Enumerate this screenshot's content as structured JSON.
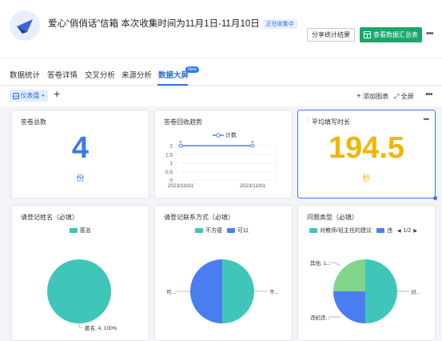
{
  "header": {
    "title": "爱心“俏俏话”信箱 本次收集时间为11月1日-11月10日",
    "status_badge": "正在收集中",
    "share_label": "分享统计结果",
    "view_data_label": "查看数据汇总表"
  },
  "tabs": [
    {
      "label": "数据统计"
    },
    {
      "label": "答卷详情"
    },
    {
      "label": "交叉分析"
    },
    {
      "label": "来源分析"
    },
    {
      "label": "数据大屏",
      "badge": "New",
      "active": true
    }
  ],
  "toolbar": {
    "dashboard_label": "仪表盘",
    "add_chart_label": "添加图表",
    "fullscreen_label": "全屏"
  },
  "cards": {
    "total": {
      "title": "答卷总数",
      "value": "4",
      "unit": "份"
    },
    "trend": {
      "title": "答卷回收趋势",
      "legend": "计数"
    },
    "avg_time": {
      "title": "平均填写时长",
      "value": "194.5",
      "unit": "秒"
    },
    "q1": {
      "title": "请登记姓名（必填）",
      "legend": "匿名",
      "label": "匿名, 4, 100%"
    },
    "q2": {
      "title": "请登记联系方式（必填）",
      "legends": [
        "不方便",
        "可以"
      ],
      "label_left": "可...",
      "label_right": "不..."
    },
    "q3": {
      "title": "问题类型（必填）",
      "legends": [
        "对教师/班主任的建议",
        "违"
      ],
      "pager": "1/2",
      "label_tl": "其他, 1...",
      "label_bl": "违纪违...",
      "label_r": "对..."
    }
  },
  "chart_data": [
    {
      "type": "line",
      "title": "答卷回收趋势",
      "x": [
        "2023/10/31",
        "2023/11/01"
      ],
      "series": [
        {
          "name": "计数",
          "values": [
            2,
            2
          ]
        }
      ],
      "yticks": [
        "0",
        "0.5",
        "1",
        "1.5",
        "2"
      ],
      "ylim": [
        0,
        2
      ],
      "data_labels": [
        "2",
        "2"
      ],
      "grid": true,
      "legend": "top"
    },
    {
      "type": "pie",
      "title": "请登记姓名（必填）",
      "series": [
        {
          "name": "匿名",
          "value": 4,
          "percent": 100,
          "color": "#3fc6b8"
        }
      ]
    },
    {
      "type": "pie",
      "title": "请登记联系方式（必填）",
      "series": [
        {
          "name": "不方便",
          "value": 2,
          "color": "#3fc6b8"
        },
        {
          "name": "可以",
          "value": 2,
          "color": "#4a7ef0"
        }
      ]
    },
    {
      "type": "pie",
      "title": "问题类型（必填）",
      "series": [
        {
          "name": "对教师/班主任的建议",
          "value": 2,
          "color": "#3fc6b8"
        },
        {
          "name": "违纪违规",
          "value": 1,
          "color": "#4a7ef0"
        },
        {
          "name": "其他",
          "value": 1,
          "color": "#82d48a"
        }
      ]
    }
  ],
  "colors": {
    "accent": "#2a6fdb",
    "green": "#1aa76c",
    "big_number": "#f2b600",
    "blue_number": "#3b7be8"
  }
}
